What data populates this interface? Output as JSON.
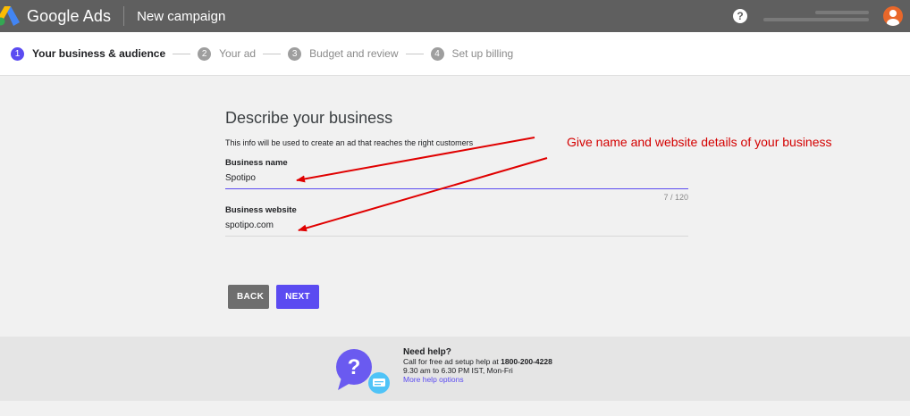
{
  "header": {
    "brand": "Google Ads",
    "page_title": "New campaign",
    "help_icon_glyph": "?",
    "icons": [
      "google-ads-logo-icon",
      "help-icon",
      "account-avatar-icon"
    ]
  },
  "stepper": {
    "steps": [
      {
        "number": "1",
        "label": "Your business & audience",
        "active": true
      },
      {
        "number": "2",
        "label": "Your ad",
        "active": false
      },
      {
        "number": "3",
        "label": "Budget and review",
        "active": false
      },
      {
        "number": "4",
        "label": "Set up billing",
        "active": false
      }
    ]
  },
  "form": {
    "heading": "Describe your business",
    "subheading": "This info will be used to create an ad that reaches the right customers",
    "business_name": {
      "label": "Business name",
      "value": "Spotipo",
      "counter": "7 / 120"
    },
    "business_website": {
      "label": "Business website",
      "value": "spotipo.com"
    }
  },
  "buttons": {
    "back": "BACK",
    "next": "NEXT"
  },
  "help": {
    "title": "Need help?",
    "line1_prefix": "Call for free ad setup help at ",
    "phone": "1800-200-4228",
    "hours": "9.30 am to 6.30 PM IST, Mon-Fri",
    "link": "More help options"
  },
  "annotation": {
    "text": "Give name and website details of your business",
    "color": "#d40000"
  },
  "colors": {
    "header_bg": "#5f5f5f",
    "accent": "#5b4bf1",
    "back_button": "#6e6e6e",
    "page_bg": "#f1f1f1",
    "avatar": "#e8672a"
  }
}
